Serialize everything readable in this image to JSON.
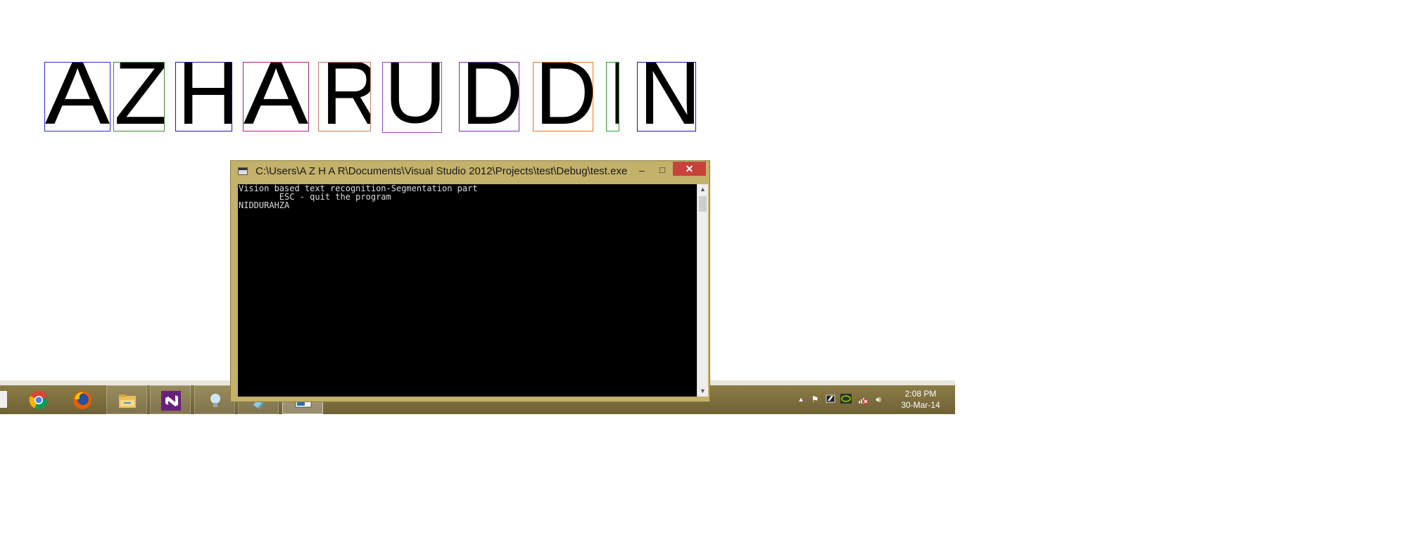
{
  "segmentation": {
    "letters": [
      "A",
      "Z",
      "H",
      "A",
      "R",
      "U",
      "D",
      "D",
      "I",
      "N"
    ],
    "box_colors": [
      "#2b2bd9",
      "#3a8a2a",
      "#1a1a9a",
      "#b0207a",
      "#d07a5a",
      "#a040c0",
      "#7a30b0",
      "#e07a20",
      "#30a030",
      "#1a1a9a"
    ]
  },
  "console": {
    "title": "C:\\Users\\A Z H A R\\Documents\\Visual Studio 2012\\Projects\\test\\Debug\\test.exe",
    "lines": [
      "Vision based text recognition-Segmentation part",
      "        ESC - quit the program",
      "NIDDURAHZA"
    ],
    "buttons": {
      "minimize": "–",
      "maximize": "□",
      "close": "✕"
    }
  },
  "taskbar": {
    "apps": [
      {
        "name": "chrome-icon",
        "state": "pinned"
      },
      {
        "name": "firefox-icon",
        "state": "pinned"
      },
      {
        "name": "file-explorer-icon",
        "state": "open"
      },
      {
        "name": "visual-studio-icon",
        "state": "open"
      },
      {
        "name": "lightbulb-icon",
        "state": "open"
      },
      {
        "name": "notepad-icon",
        "state": "open"
      },
      {
        "name": "console-app-icon",
        "state": "active"
      }
    ],
    "tray_icons": [
      "show-hidden-icons-arrow",
      "action-center-flag-icon",
      "app-tray-icon",
      "nvidia-icon",
      "network-disconnected-icon",
      "volume-icon"
    ],
    "clock": {
      "time": "2:08 PM",
      "date": "30-Mar-14"
    }
  },
  "colors": {
    "taskbar": "#7d6e3e",
    "console_frame": "#c4b16a",
    "close_button": "#c7423a"
  }
}
